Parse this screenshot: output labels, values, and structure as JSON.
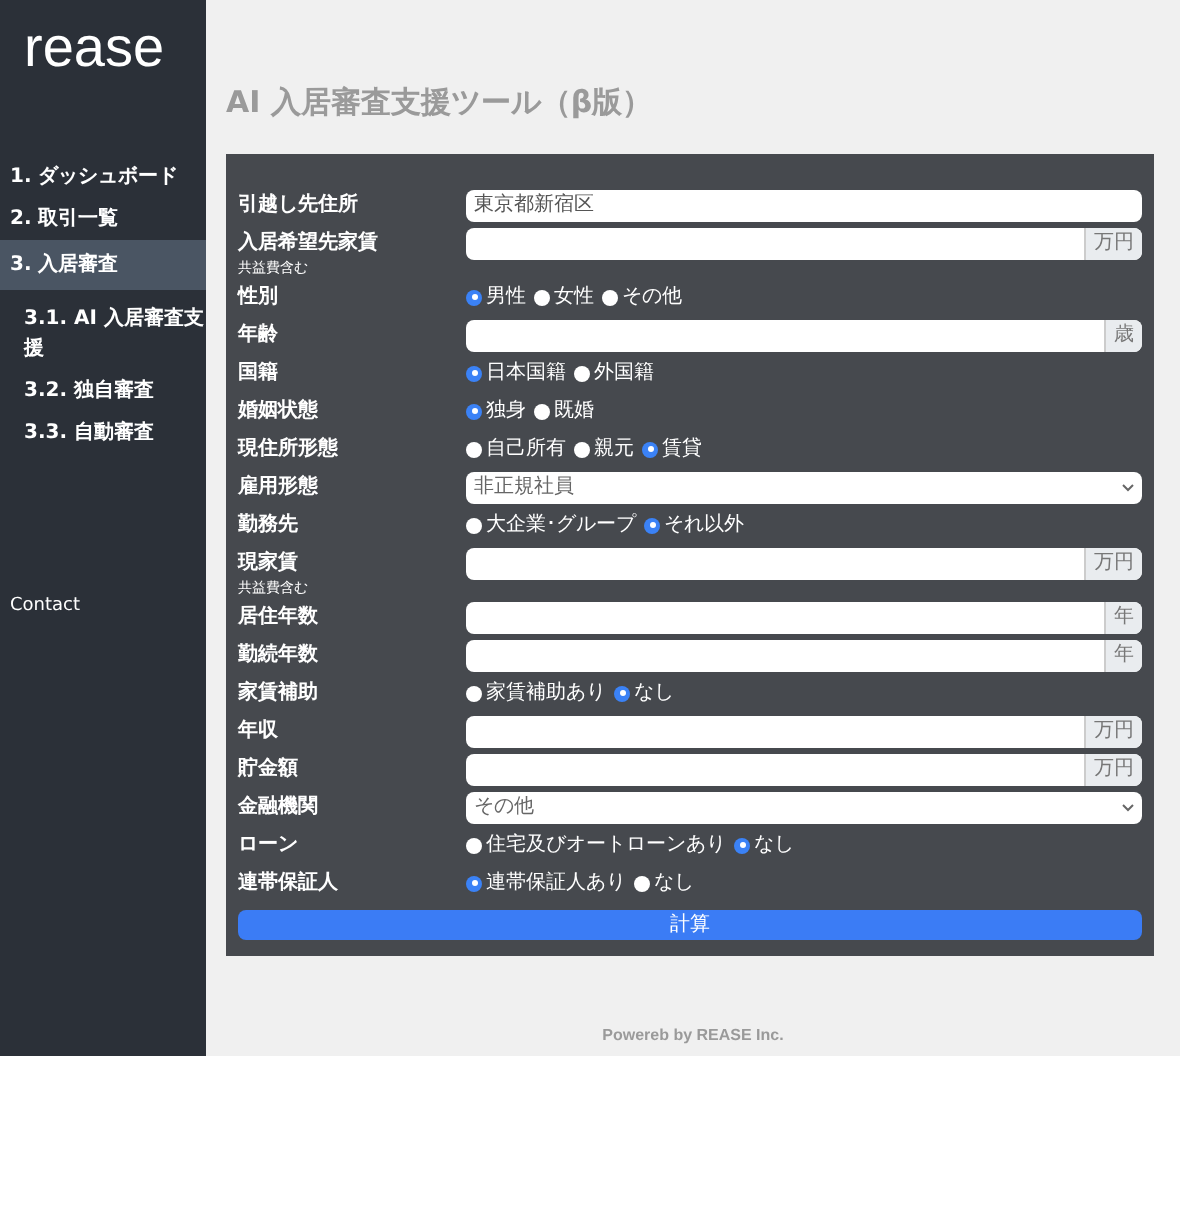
{
  "sidebar": {
    "logo": "rease",
    "nav": [
      {
        "label": "1. ダッシュボード",
        "selected": false
      },
      {
        "label": "2. 取引一覧",
        "selected": false
      },
      {
        "label": "3. 入居審査",
        "selected": true,
        "children": [
          {
            "label": "3.1. AI 入居審査支援",
            "selected": false
          },
          {
            "label": "3.2. 独自審査",
            "selected": false
          },
          {
            "label": "3.3. 自動審査",
            "selected": false
          }
        ]
      }
    ],
    "contact": "Contact"
  },
  "page_title": "AI 入居審査支援ツール（β版）",
  "form": {
    "rows": [
      {
        "kind": "text",
        "label": "引越し先住所",
        "value": "東京都新宿区"
      },
      {
        "kind": "text",
        "label": "入居希望先家賃",
        "sublabel": "共益費含む",
        "unit": "万円"
      },
      {
        "kind": "radio",
        "label": "性別",
        "options": [
          {
            "label": "男性",
            "selected": true
          },
          {
            "label": "女性",
            "selected": false
          },
          {
            "label": "その他",
            "selected": false
          }
        ]
      },
      {
        "kind": "text",
        "label": "年齢",
        "unit": "歳"
      },
      {
        "kind": "radio",
        "label": "国籍",
        "options": [
          {
            "label": "日本国籍",
            "selected": true
          },
          {
            "label": "外国籍",
            "selected": false
          }
        ]
      },
      {
        "kind": "radio",
        "label": "婚姻状態",
        "options": [
          {
            "label": "独身",
            "selected": true
          },
          {
            "label": "既婚",
            "selected": false
          }
        ]
      },
      {
        "kind": "radio",
        "label": "現住所形態",
        "options": [
          {
            "label": "自己所有",
            "selected": false
          },
          {
            "label": "親元",
            "selected": false
          },
          {
            "label": "賃貸",
            "selected": true
          }
        ]
      },
      {
        "kind": "select",
        "label": "雇用形態",
        "value": "非正規社員"
      },
      {
        "kind": "radio",
        "label": "勤務先",
        "options": [
          {
            "label": "大企業･グループ",
            "selected": false
          },
          {
            "label": "それ以外",
            "selected": true
          }
        ]
      },
      {
        "kind": "text",
        "label": "現家賃",
        "sublabel": "共益費含む",
        "unit": "万円"
      },
      {
        "kind": "text",
        "label": "居住年数",
        "unit": "年"
      },
      {
        "kind": "text",
        "label": "勤続年数",
        "unit": "年"
      },
      {
        "kind": "radio",
        "label": "家賃補助",
        "options": [
          {
            "label": "家賃補助あり",
            "selected": false
          },
          {
            "label": "なし",
            "selected": true
          }
        ]
      },
      {
        "kind": "text",
        "label": "年収",
        "unit": "万円"
      },
      {
        "kind": "text",
        "label": "貯金額",
        "unit": "万円"
      },
      {
        "kind": "select",
        "label": "金融機関",
        "value": "その他"
      },
      {
        "kind": "radio",
        "label": "ローン",
        "options": [
          {
            "label": "住宅及びオートローンあり",
            "selected": false
          },
          {
            "label": "なし",
            "selected": true
          }
        ]
      },
      {
        "kind": "radio",
        "label": "連帯保証人",
        "options": [
          {
            "label": "連帯保証人あり",
            "selected": true
          },
          {
            "label": "なし",
            "selected": false
          }
        ]
      }
    ],
    "submit": "計算"
  },
  "footer": "Powereb by REASE Inc."
}
